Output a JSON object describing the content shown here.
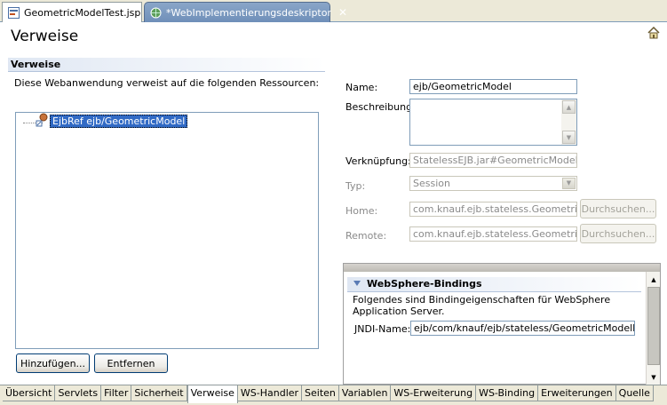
{
  "tabs": [
    {
      "label": "GeometricModelTest.jsp",
      "active": false
    },
    {
      "label": "*WebImplementierungsdeskriptor",
      "active": true
    }
  ],
  "page_title": "Verweise",
  "left": {
    "section_title": "Verweise",
    "description": "Diese Webanwendung verweist auf die folgenden Ressourcen:",
    "tree_item": "EjbRef ejb/GeometricModel",
    "add_button": "Hinzufügen...",
    "remove_button": "Entfernen"
  },
  "form": {
    "name_label": "Name:",
    "name_value": "ejb/GeometricModel",
    "description_label": "Beschreibung:",
    "link_label": "Verknüpfung:",
    "link_value": "StatelessEJB.jar#GeometricModel",
    "type_label": "Typ:",
    "type_value": "Session",
    "home_label": "Home:",
    "home_value": "com.knauf.ejb.stateless.GeometricMc",
    "home_browse": "Durchsuchen...",
    "remote_label": "Remote:",
    "remote_value": "com.knauf.ejb.stateless.GeometricMc",
    "remote_browse": "Durchsuchen..."
  },
  "bindings": {
    "title": "WebSphere-Bindings",
    "description": "Folgendes sind Bindingeigenschaften für WebSphere Application Server.",
    "jndi_label": "JNDI-Name:",
    "jndi_value": "ejb/com/knauf/ejb/stateless/GeometricModelHome"
  },
  "page_tabs": [
    "Übersicht",
    "Servlets",
    "Filter",
    "Sicherheit",
    "Verweise",
    "WS-Handler",
    "Seiten",
    "Variablen",
    "WS-Erweiterung",
    "WS-Binding",
    "Erweiterungen",
    "Quelle"
  ],
  "active_page_tab": "Verweise",
  "colors": {
    "accent": "#316ac5",
    "section_header": "#dfe7f3",
    "active_tab": "#7a97bf"
  }
}
